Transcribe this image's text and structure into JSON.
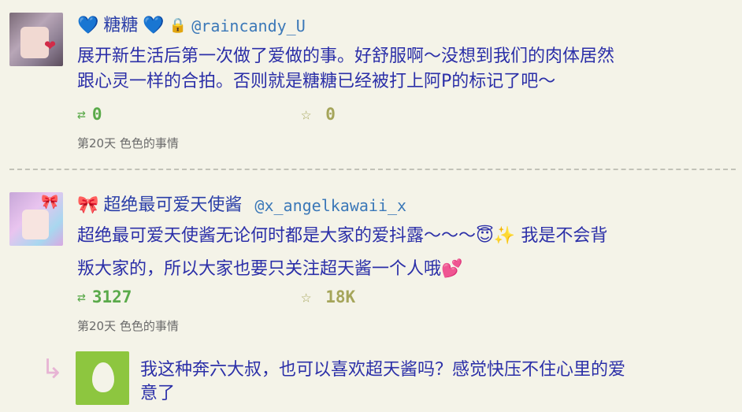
{
  "posts": [
    {
      "name": "糖糖",
      "name_decor_left": "💙",
      "name_decor_right": "💙",
      "lock_icon": "🔒",
      "handle": "@raincandy_U",
      "lines": [
        "展开新生活后第一次做了爱做的事。好舒服啊～没想到我们的肉体居然",
        "跟心灵一样的合拍。否则就是糖糖已经被打上阿P的标记了吧～"
      ],
      "retweets": "0",
      "likes": "0",
      "meta": "第20天 色色的事情"
    },
    {
      "name": "超绝最可爱天使酱",
      "name_decor_left": "🎀",
      "name_decor_mid": "🎀",
      "handle": "@x_angelkawaii_x",
      "lines": [
        "超绝最可爱天使酱无论何时都是大家的爱抖露～～～😇✨ 我是不会背",
        "叛大家的，所以大家也要只关注超天酱一个人哦💕"
      ],
      "retweets": "3127",
      "likes": "18K",
      "meta": "第20天 色色的事情"
    }
  ],
  "reply": {
    "arrow": "↳",
    "lines": [
      "我这种奔六大叔，也可以喜欢超天酱吗？感觉快压不住心里的爱",
      "意了"
    ]
  },
  "icons": {
    "retweet": "⇄",
    "star": "☆"
  }
}
